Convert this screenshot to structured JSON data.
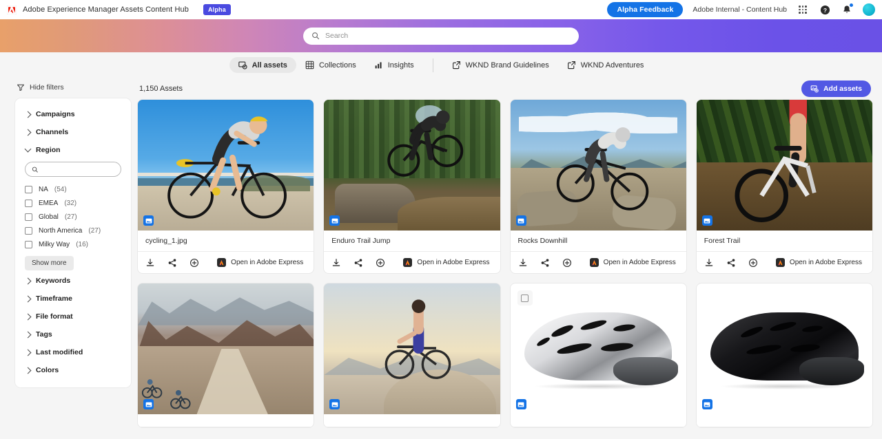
{
  "topbar": {
    "brand_title": "Adobe Experience Manager Assets Content Hub",
    "alpha_tag": "Alpha",
    "alpha_feedback": "Alpha Feedback",
    "org_label": "Adobe Internal - Content Hub",
    "icons": [
      "app-switcher-icon",
      "help-icon",
      "notifications-icon",
      "avatar"
    ]
  },
  "search": {
    "placeholder": "Search",
    "value": ""
  },
  "tabs": [
    {
      "label": "All assets",
      "icon": "all-assets-icon",
      "active": true
    },
    {
      "label": "Collections",
      "icon": "grid-icon",
      "active": false
    },
    {
      "label": "Insights",
      "icon": "chart-icon",
      "active": false
    },
    {
      "label": "WKND Brand Guidelines",
      "icon": "external-link-icon",
      "active": false
    },
    {
      "label": "WKND Adventures",
      "icon": "external-link-icon",
      "active": false
    }
  ],
  "sidebar": {
    "hide_filters": "Hide filters",
    "sections": [
      {
        "label": "Campaigns",
        "expanded": false
      },
      {
        "label": "Channels",
        "expanded": false
      },
      {
        "label": "Region",
        "expanded": true
      },
      {
        "label": "Keywords",
        "expanded": false
      },
      {
        "label": "Timeframe",
        "expanded": false
      },
      {
        "label": "File format",
        "expanded": false
      },
      {
        "label": "Tags",
        "expanded": false
      },
      {
        "label": "Last modified",
        "expanded": false
      },
      {
        "label": "Colors",
        "expanded": false
      }
    ],
    "region": {
      "search_placeholder": "",
      "options": [
        {
          "label": "NA",
          "count": "(54)",
          "checked": false
        },
        {
          "label": "EMEA",
          "count": "(32)",
          "checked": false
        },
        {
          "label": "Global",
          "count": "(27)",
          "checked": false
        },
        {
          "label": "North America",
          "count": "(27)",
          "checked": false
        },
        {
          "label": "Milky Way",
          "count": "(16)",
          "checked": false
        }
      ],
      "show_more": "Show more"
    }
  },
  "main": {
    "assets_count": "1,150 Assets",
    "add_assets": "Add assets",
    "express_label": "Open in Adobe Express",
    "cards": [
      {
        "title": "cycling_1.jpg",
        "thumb": "t-road",
        "selected": false,
        "badge": "image-type-icon"
      },
      {
        "title": "Enduro Trail Jump",
        "thumb": "t-enduro",
        "selected": false,
        "badge": "image-type-icon"
      },
      {
        "title": "Rocks Downhill",
        "thumb": "t-rocks",
        "selected": false,
        "badge": "image-type-icon"
      },
      {
        "title": "Forest Trail",
        "thumb": "t-forest",
        "selected": false,
        "badge": "image-type-icon"
      },
      {
        "title": "",
        "thumb": "t-canyon",
        "selected": false,
        "badge": "image-type-icon"
      },
      {
        "title": "",
        "thumb": "t-summit",
        "selected": false,
        "badge": "image-type-icon"
      },
      {
        "title": "",
        "thumb": "t-white-h",
        "selected": true,
        "badge": "image-type-icon"
      },
      {
        "title": "",
        "thumb": "t-black-h",
        "selected": false,
        "badge": "image-type-icon"
      }
    ]
  },
  "colors": {
    "accent_blue": "#1473e6",
    "add_assets_purple": "#5258e4",
    "alpha_tag_purple": "#4a4ae0",
    "adobe_red": "#eb1000"
  }
}
